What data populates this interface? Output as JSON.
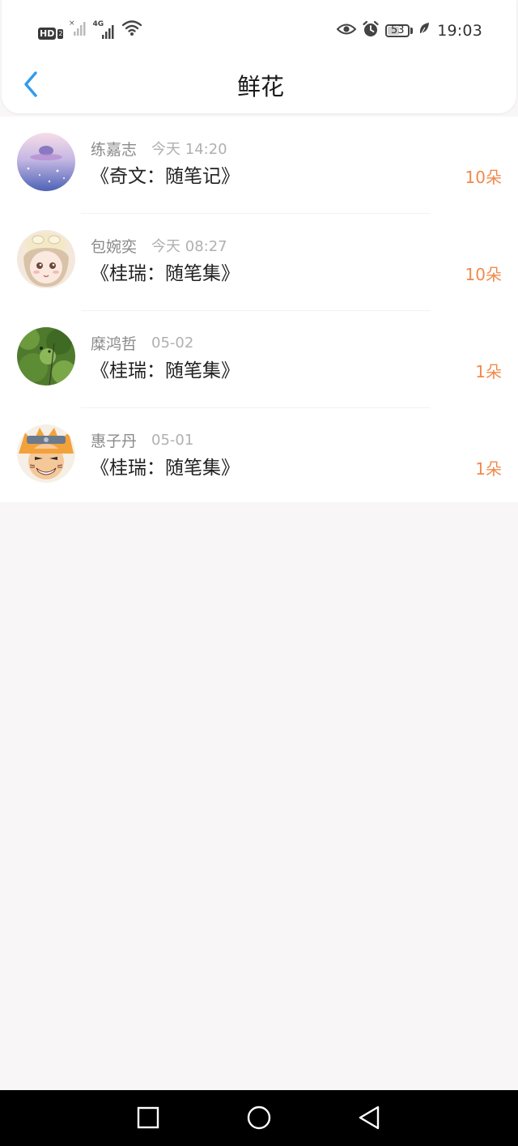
{
  "status_bar": {
    "hd_label": "HD",
    "sim_label": "2",
    "network_label": "4G",
    "battery_level": "53",
    "time": "19:03"
  },
  "header": {
    "title": "鲜花",
    "back_icon": "chevron-left-icon"
  },
  "colors": {
    "accent_blue": "#2e9bf0",
    "flower_count_orange": "#f08a4b",
    "page_background": "#f8f6f7"
  },
  "flowers": [
    {
      "name": "练嘉志",
      "time": "今天 14:20",
      "work": "《奇文：随笔记》",
      "count": "10朵"
    },
    {
      "name": "包婉奕",
      "time": "今天 08:27",
      "work": "《桂瑞：随笔集》",
      "count": "10朵"
    },
    {
      "name": "糜鸿哲",
      "time": "05-02",
      "work": "《桂瑞：随笔集》",
      "count": "1朵"
    },
    {
      "name": "惠子丹",
      "time": "05-01",
      "work": "《桂瑞：随笔集》",
      "count": "1朵"
    }
  ],
  "system_nav": {
    "recent_icon": "square-icon",
    "home_icon": "circle-icon",
    "back_icon": "triangle-back-icon"
  }
}
